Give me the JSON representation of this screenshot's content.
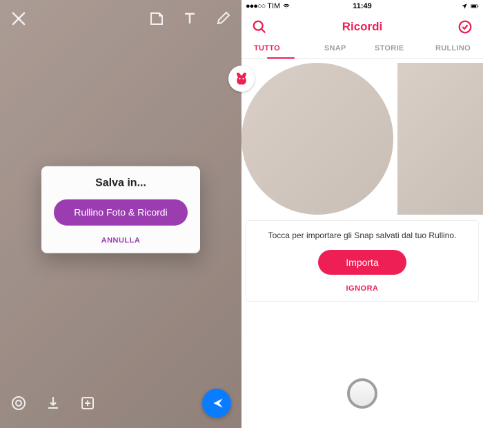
{
  "left": {
    "modal": {
      "title": "Salva in...",
      "primary_button": "Rullino Foto & Ricordi",
      "cancel": "ANNULLA"
    }
  },
  "right": {
    "statusbar": {
      "signal": "●●●○○",
      "carrier": "TIM",
      "time": "11:49"
    },
    "nav": {
      "title": "Ricordi"
    },
    "tabs": {
      "all": "TUTTO",
      "snap": "SNAP",
      "stories": "STORIE",
      "roll": "RULLINO"
    },
    "import_card": {
      "text": "Tocca per importare gli Snap salvati dal tuo Rullino.",
      "import_btn": "Importa",
      "ignore": "IGNORA"
    }
  },
  "colors": {
    "accent_purple": "#9b3db1",
    "accent_red": "#ed1f55",
    "send_blue": "#0a7cff"
  }
}
